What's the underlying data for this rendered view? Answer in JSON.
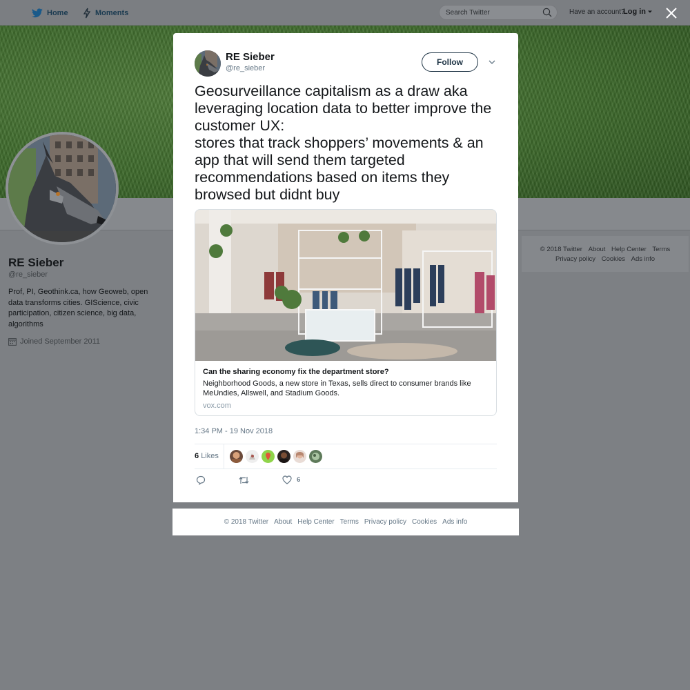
{
  "topbar": {
    "home_label": "Home",
    "moments_label": "Moments",
    "search_placeholder": "Search Twitter",
    "have_account_text": "Have an account?",
    "login_label": "Log in"
  },
  "profile": {
    "name": "RE Sieber",
    "handle": "@re_sieber",
    "bio": "Prof, PI, Geothink.ca, how Geoweb, open data transforms cities. GIScience, civic participation, citizen science, big data, algorithms",
    "joined": "Joined September 2011"
  },
  "side_footer": {
    "links": [
      "© 2018 Twitter",
      "About",
      "Help Center",
      "Terms",
      "Privacy policy",
      "Cookies",
      "Ads info"
    ]
  },
  "tweet": {
    "author_name": "RE Sieber",
    "author_handle": "@re_sieber",
    "follow_label": "Follow",
    "text": "Geosurveillance capitalism as a draw aka leveraging location data to better improve the customer UX:\nstores that track shoppers’ movements & an app that will send them targeted recommendations based on items they browsed but didnt buy",
    "card": {
      "title": "Can the sharing economy fix the department store?",
      "description": "Neighborhood Goods, a new store in Texas, sells direct to consumer brands like MeUndies, Allswell, and Stadium Goods.",
      "domain": "vox.com"
    },
    "timestamp": "1:34 PM - 19 Nov 2018",
    "likes_number": "6",
    "likes_word": "Likes",
    "like_count": "6"
  },
  "modal_footer": {
    "links": [
      "© 2018 Twitter",
      "About",
      "Help Center",
      "Terms",
      "Privacy policy",
      "Cookies",
      "Ads info"
    ]
  },
  "colors": {
    "overlay": "#7d8084",
    "grass": "#3e6a2c",
    "text_primary": "#14171a",
    "text_secondary": "#657786"
  }
}
